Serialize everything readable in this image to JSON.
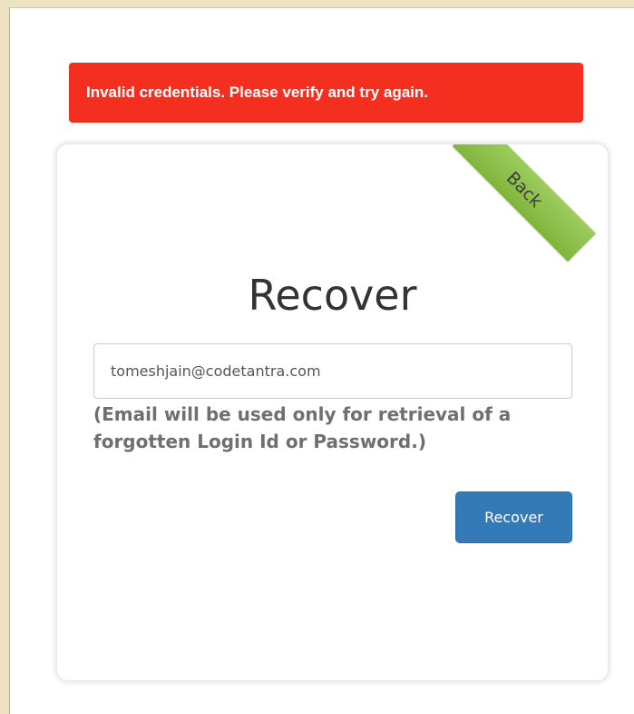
{
  "alert": {
    "message": "Invalid credentials. Please verify and try again.",
    "color": "#f42f1f"
  },
  "card": {
    "ribbon_label": "Back",
    "ribbon_color": "#8bc34a",
    "title": "Recover",
    "email_value": "tomeshjain@codetantra.com",
    "hint": "(Email will be used only for retrieval of a forgotten Login Id or Password.)",
    "recover_button_label": "Recover",
    "button_color": "#337ab7"
  }
}
